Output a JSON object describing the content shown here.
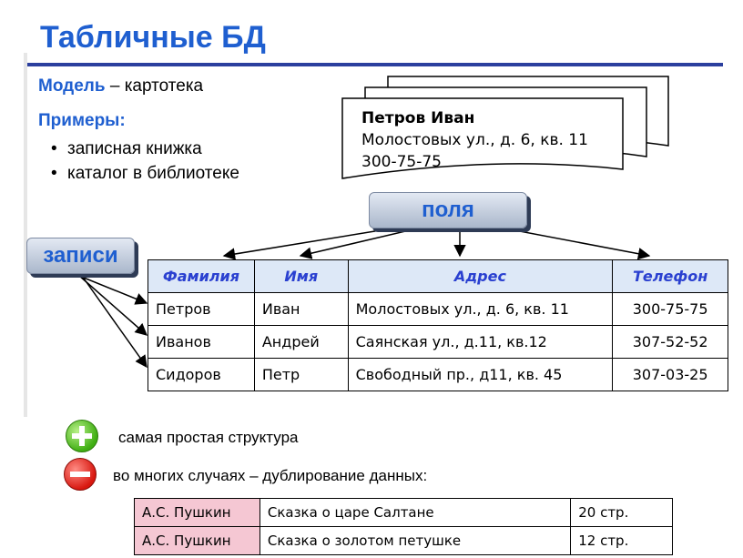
{
  "title": "Табличные БД",
  "model": {
    "label": "Модель",
    "dash": " – ",
    "value": "картотека"
  },
  "examples": {
    "title": "Примеры:",
    "items": [
      "записная книжка",
      "каталог в библиотеке"
    ]
  },
  "card": {
    "name": "Петров Иван",
    "address": "Молостовых ул., д. 6, кв. 11",
    "phone": "300-75-75"
  },
  "labels": {
    "fields": "поля",
    "records": "записи"
  },
  "main_table": {
    "headers": [
      "Фамилия",
      "Имя",
      "Адрес",
      "Телефон"
    ],
    "rows": [
      [
        "Петров",
        "Иван",
        "Молостовых ул., д. 6, кв. 11",
        "300-75-75"
      ],
      [
        "Иванов",
        "Андрей",
        "Саянская ул., д.11, кв.12",
        "307-52-52"
      ],
      [
        "Сидоров",
        "Петр",
        "Свободный пр., д11, кв. 45",
        "307-03-25"
      ]
    ]
  },
  "pros": {
    "icon": "plus-icon",
    "color": "#3fae12",
    "text": "самая простая структура"
  },
  "cons": {
    "icon": "minus-icon",
    "color": "#d8170f",
    "text": "во многих случаях – дублирование данных:"
  },
  "book_table": {
    "rows": [
      [
        "А.С. Пушкин",
        "Сказка о царе Салтане",
        "20 стр."
      ],
      [
        "А.С. Пушкин",
        "Сказка о золотом петушке",
        "12 стр."
      ]
    ]
  },
  "colors": {
    "title": "#1f5fd0",
    "rule": "#2b3f9e",
    "header_bg": "#dde8f7",
    "author_bg": "#f5c7d3"
  }
}
